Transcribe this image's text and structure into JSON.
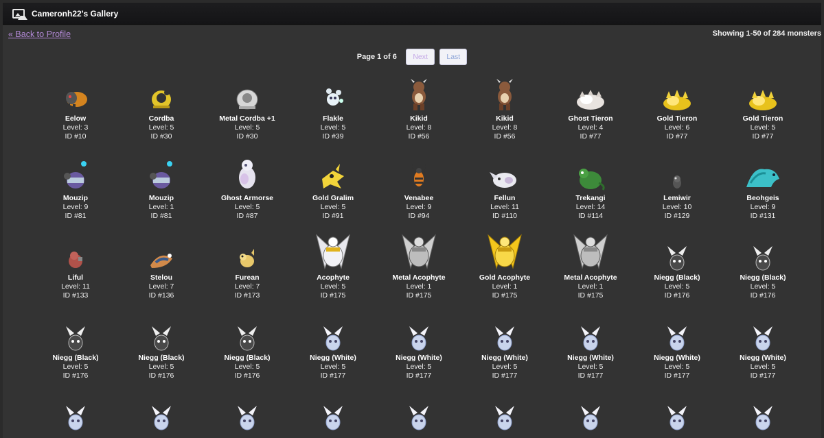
{
  "window": {
    "title": "Cameronh22's Gallery",
    "icon": "gallery-image-icon"
  },
  "nav": {
    "back_label": "« Back to Profile"
  },
  "summary": {
    "showing": "Showing 1-50 of 284 monsters"
  },
  "pagination": {
    "page_info": "Page 1 of 6",
    "next_label": "Next",
    "last_label": "Last"
  },
  "colors": {
    "link": "#b48ad8",
    "background": "#333333",
    "titlebar": "#18181a"
  },
  "monsters": [
    {
      "name": "Eelow",
      "level": "Level: 3",
      "id": "ID #10",
      "sprite": "eelow-sprite"
    },
    {
      "name": "Cordba",
      "level": "Level: 5",
      "id": "ID #30",
      "sprite": "cordba-sprite"
    },
    {
      "name": "Metal Cordba +1",
      "level": "Level: 5",
      "id": "ID #30",
      "sprite": "metal-cordba-sprite"
    },
    {
      "name": "Flakle",
      "level": "Level: 5",
      "id": "ID #39",
      "sprite": "flakle-sprite"
    },
    {
      "name": "Kikid",
      "level": "Level: 8",
      "id": "ID #56",
      "sprite": "kikid-sprite"
    },
    {
      "name": "Kikid",
      "level": "Level: 8",
      "id": "ID #56",
      "sprite": "kikid-sprite"
    },
    {
      "name": "Ghost Tieron",
      "level": "Level: 4",
      "id": "ID #77",
      "sprite": "ghost-tieron-sprite"
    },
    {
      "name": "Gold Tieron",
      "level": "Level: 6",
      "id": "ID #77",
      "sprite": "gold-tieron-sprite"
    },
    {
      "name": "Gold Tieron",
      "level": "Level: 5",
      "id": "ID #77",
      "sprite": "gold-tieron-sprite"
    },
    {
      "name": "Mouzip",
      "level": "Level: 9",
      "id": "ID #81",
      "sprite": "mouzip-sprite"
    },
    {
      "name": "Mouzip",
      "level": "Level: 1",
      "id": "ID #81",
      "sprite": "mouzip-sprite"
    },
    {
      "name": "Ghost Armorse",
      "level": "Level: 5",
      "id": "ID #87",
      "sprite": "ghost-armorse-sprite"
    },
    {
      "name": "Gold Gralim",
      "level": "Level: 5",
      "id": "ID #91",
      "sprite": "gold-gralim-sprite"
    },
    {
      "name": "Venabee",
      "level": "Level: 9",
      "id": "ID #94",
      "sprite": "venabee-sprite"
    },
    {
      "name": "Fellun",
      "level": "Level: 11",
      "id": "ID #110",
      "sprite": "fellun-sprite"
    },
    {
      "name": "Trekangi",
      "level": "Level: 14",
      "id": "ID #114",
      "sprite": "trekangi-sprite"
    },
    {
      "name": "Lemiwir",
      "level": "Level: 10",
      "id": "ID #129",
      "sprite": "lemiwir-sprite"
    },
    {
      "name": "Beohgeis",
      "level": "Level: 9",
      "id": "ID #131",
      "sprite": "beohgeis-sprite"
    },
    {
      "name": "Liful",
      "level": "Level: 11",
      "id": "ID #133",
      "sprite": "liful-sprite"
    },
    {
      "name": "Stelou",
      "level": "Level: 7",
      "id": "ID #136",
      "sprite": "stelou-sprite"
    },
    {
      "name": "Furean",
      "level": "Level: 7",
      "id": "ID #173",
      "sprite": "furean-sprite"
    },
    {
      "name": "Acophyte",
      "level": "Level: 5",
      "id": "ID #175",
      "sprite": "acophyte-sprite"
    },
    {
      "name": "Metal Acophyte",
      "level": "Level: 1",
      "id": "ID #175",
      "sprite": "metal-acophyte-sprite"
    },
    {
      "name": "Gold Acophyte",
      "level": "Level: 1",
      "id": "ID #175",
      "sprite": "gold-acophyte-sprite"
    },
    {
      "name": "Metal Acophyte",
      "level": "Level: 1",
      "id": "ID #175",
      "sprite": "metal-acophyte-sprite"
    },
    {
      "name": "Niegg (Black)",
      "level": "Level: 5",
      "id": "ID #176",
      "sprite": "niegg-black-sprite"
    },
    {
      "name": "Niegg (Black)",
      "level": "Level: 5",
      "id": "ID #176",
      "sprite": "niegg-black-sprite"
    },
    {
      "name": "Niegg (Black)",
      "level": "Level: 5",
      "id": "ID #176",
      "sprite": "niegg-black-sprite"
    },
    {
      "name": "Niegg (Black)",
      "level": "Level: 5",
      "id": "ID #176",
      "sprite": "niegg-black-sprite"
    },
    {
      "name": "Niegg (Black)",
      "level": "Level: 5",
      "id": "ID #176",
      "sprite": "niegg-black-sprite"
    },
    {
      "name": "Niegg (White)",
      "level": "Level: 5",
      "id": "ID #177",
      "sprite": "niegg-white-sprite"
    },
    {
      "name": "Niegg (White)",
      "level": "Level: 5",
      "id": "ID #177",
      "sprite": "niegg-white-sprite"
    },
    {
      "name": "Niegg (White)",
      "level": "Level: 5",
      "id": "ID #177",
      "sprite": "niegg-white-sprite"
    },
    {
      "name": "Niegg (White)",
      "level": "Level: 5",
      "id": "ID #177",
      "sprite": "niegg-white-sprite"
    },
    {
      "name": "Niegg (White)",
      "level": "Level: 5",
      "id": "ID #177",
      "sprite": "niegg-white-sprite"
    },
    {
      "name": "Niegg (White)",
      "level": "Level: 5",
      "id": "ID #177",
      "sprite": "niegg-white-sprite"
    },
    {
      "name": "",
      "level": "",
      "id": "",
      "sprite": "niegg-white-sprite"
    },
    {
      "name": "",
      "level": "",
      "id": "",
      "sprite": "niegg-white-sprite"
    },
    {
      "name": "",
      "level": "",
      "id": "",
      "sprite": "niegg-white-sprite"
    },
    {
      "name": "",
      "level": "",
      "id": "",
      "sprite": "niegg-white-sprite"
    },
    {
      "name": "",
      "level": "",
      "id": "",
      "sprite": "niegg-white-sprite"
    },
    {
      "name": "",
      "level": "",
      "id": "",
      "sprite": "niegg-white-sprite"
    },
    {
      "name": "",
      "level": "",
      "id": "",
      "sprite": "niegg-white-sprite"
    },
    {
      "name": "",
      "level": "",
      "id": "",
      "sprite": "niegg-white-sprite"
    },
    {
      "name": "",
      "level": "",
      "id": "",
      "sprite": "niegg-white-sprite"
    }
  ]
}
